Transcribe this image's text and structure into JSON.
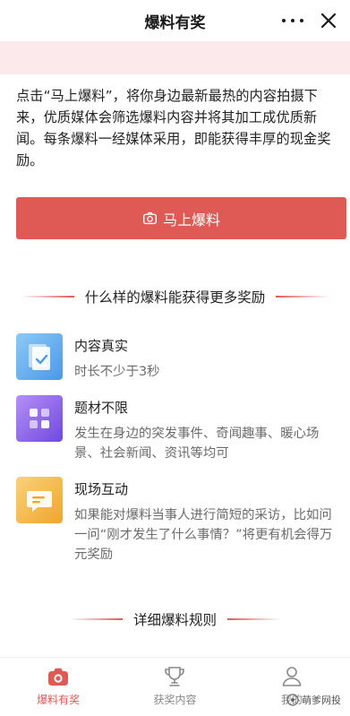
{
  "header": {
    "title": "爆料有奖"
  },
  "intro": {
    "text": "点击“马上爆料”，将你身边最新最热的内容拍摄下来，优质媒体会筛选爆料内容并将其加工成优质新闻。每条爆料一经媒体采用，即能获得丰厚的现金奖励。"
  },
  "cta": {
    "label": "马上爆料"
  },
  "section_reward": {
    "title": "什么样的爆料能获得更多奖励"
  },
  "features": [
    {
      "title": "内容真实",
      "desc": "时长不少于3秒",
      "icon": "document-check-icon",
      "color": "#5aa6f0"
    },
    {
      "title": "题材不限",
      "desc": "发生在身边的突发事件、奇闻趣事、暖心场景、社会新闻、资讯等均可",
      "icon": "grid-blocks-icon",
      "color": "#8a63e8"
    },
    {
      "title": "现场互动",
      "desc": "如果能对爆料当事人进行简短的采访，比如问一问“刚才发生了什么事情？”将更有机会得万元奖励",
      "icon": "chat-bubble-icon",
      "color": "#f2b23e"
    }
  ],
  "section_rules": {
    "title": "详细爆料规则"
  },
  "tabbar": {
    "tabs": [
      {
        "label": "爆料有奖",
        "icon": "camera-icon",
        "active": true
      },
      {
        "label": "获奖内容",
        "icon": "trophy-icon",
        "active": false
      },
      {
        "label": "我的",
        "icon": "person-icon",
        "active": false
      }
    ]
  },
  "watermark": {
    "text": "萌爹网投"
  },
  "colors": {
    "accent": "#e05a55",
    "banner": "#fbe9ec"
  }
}
